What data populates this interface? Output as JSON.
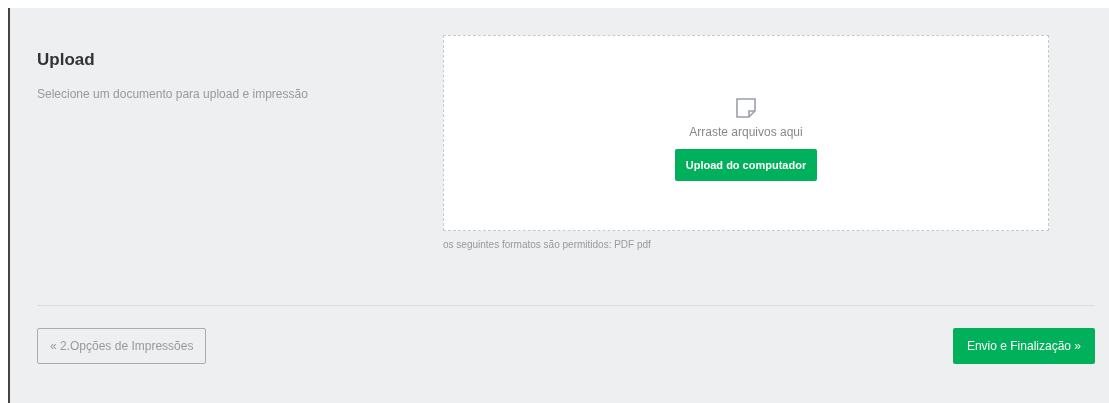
{
  "section": {
    "title": "Upload",
    "description": "Selecione um documento para upload e impressão"
  },
  "dropzone": {
    "prompt": "Arraste arquivos aqui",
    "button": "Upload do computador",
    "hint": "os seguintes formatos são permitidos: PDF pdf"
  },
  "footer": {
    "back_button": "« 2.Opções de Impressões",
    "next_button": "Envio e Finalização »"
  }
}
